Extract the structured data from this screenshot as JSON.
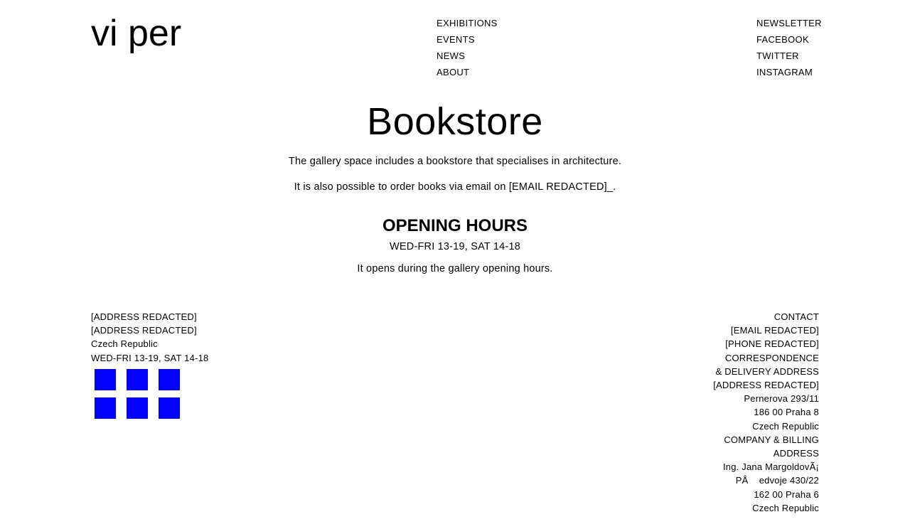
{
  "brand": {
    "logo_text": "vi per"
  },
  "nav_main": {
    "items": [
      {
        "label": "EXHIBITIONS"
      },
      {
        "label": "EVENTS"
      },
      {
        "label": "NEWS"
      },
      {
        "label": "ABOUT"
      }
    ]
  },
  "nav_social": {
    "items": [
      {
        "label": "NEWSLETTER"
      },
      {
        "label": "FACEBOOK"
      },
      {
        "label": "TWITTER"
      },
      {
        "label": "INSTAGRAM"
      }
    ]
  },
  "main": {
    "title": "Bookstore",
    "paragraph_1": "The gallery space includes a bookstore that specialises in architecture.",
    "paragraph_2": "It is also possible to order books via email on [EMAIL REDACTED]_.",
    "hours_heading": "OPENING HOURS",
    "hours_time": "WED-FRI 13-19, SAT 14-18",
    "hours_note": "It opens during the gallery opening hours."
  },
  "footer_left": {
    "lines": [
      "[ADDRESS REDACTED]",
      "[ADDRESS REDACTED]",
      "Czech Republic",
      "WED-FRI 13-19, SAT 14-18"
    ],
    "square_color": "#0000ff",
    "square_count": 6
  },
  "footer_right": {
    "lines": [
      "CONTACT",
      "[EMAIL REDACTED]",
      "[PHONE REDACTED]",
      "CORRESPONDENCE",
      "& DELIVERY ADDRESS",
      "[ADDRESS REDACTED]",
      "Pernerova 293/11",
      "186 00 Praha 8",
      "Czech Republic",
      "COMPANY & BILLING",
      "ADDRESS",
      "Ing. Jana MargoldovÃ¡",
      "PÅ    edvoje 430/22",
      "162 00 Praha 6",
      "Czech Republic"
    ]
  }
}
